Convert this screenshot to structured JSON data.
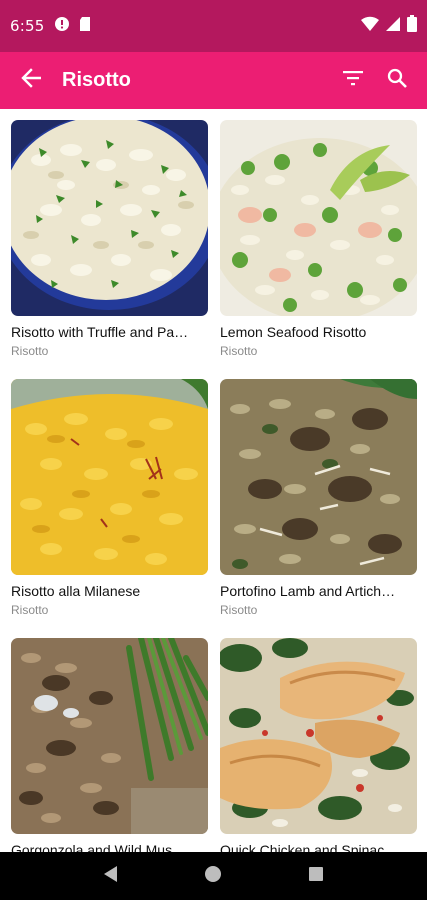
{
  "status_bar": {
    "time": "6:55",
    "icons_left": [
      "alert-circle-icon",
      "sd-card-icon"
    ],
    "icons_right": [
      "wifi-icon",
      "signal-icon",
      "battery-icon"
    ]
  },
  "app_bar": {
    "title": "Risotto",
    "back_icon": "arrow-back-icon",
    "actions": [
      "filter-icon",
      "search-icon"
    ],
    "color": "#ec1e73"
  },
  "recipes": [
    {
      "title": "Risotto with Truffle and Pa…",
      "category": "Risotto"
    },
    {
      "title": "Lemon Seafood Risotto",
      "category": "Risotto"
    },
    {
      "title": "Risotto alla Milanese",
      "category": "Risotto"
    },
    {
      "title": "Portofino Lamb and Artich…",
      "category": "Risotto"
    },
    {
      "title": "Gorgonzola and Wild Mus…",
      "category": ""
    },
    {
      "title": "Quick Chicken and Spinac…",
      "category": ""
    }
  ],
  "nav_bar": {
    "icons": [
      "back-triangle-icon",
      "home-circle-icon",
      "recents-square-icon"
    ]
  }
}
